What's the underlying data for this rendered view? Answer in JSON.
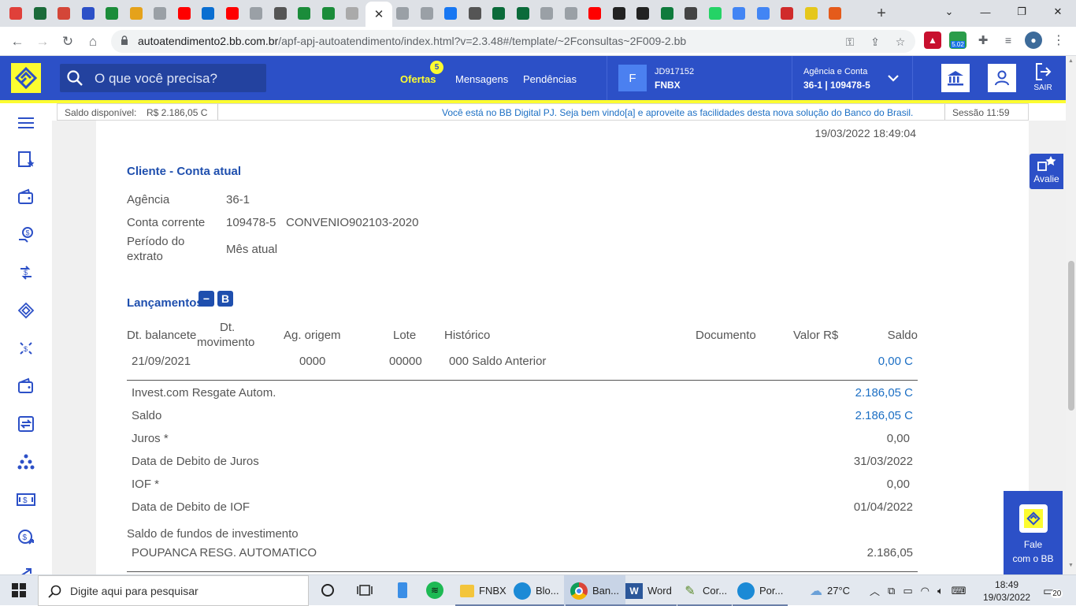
{
  "browser": {
    "tabs": [
      {
        "icon": "download-icon",
        "color": "#e0403a"
      },
      {
        "icon": "ps-icon",
        "color": "#1b6b3a"
      },
      {
        "icon": "gmail-icon",
        "color": "#d44638"
      },
      {
        "icon": "bb-icon",
        "color": "#2c50c7"
      },
      {
        "icon": "flag-icon",
        "color": "#1b8c3a"
      },
      {
        "icon": "pinwheel-icon",
        "color": "#e5a21b"
      },
      {
        "icon": "globe-icon",
        "color": "#9aa0a6"
      },
      {
        "icon": "youtube-icon",
        "color": "#ff0000"
      },
      {
        "icon": "outlook-icon",
        "color": "#0a6ed1"
      },
      {
        "icon": "youtube-icon",
        "color": "#ff0000"
      },
      {
        "icon": "globe-icon",
        "color": "#9aa0a6"
      },
      {
        "icon": "inn-icon",
        "color": "#555555"
      },
      {
        "icon": "flag-icon",
        "color": "#1b8c3a"
      },
      {
        "icon": "flag-icon",
        "color": "#1b8c3a"
      },
      {
        "icon": "doc-icon",
        "color": "#aaaaaa"
      }
    ],
    "active_tab_close": "✕",
    "tabs_after": [
      {
        "icon": "globe-icon",
        "color": "#9aa0a6"
      },
      {
        "icon": "globe-icon",
        "color": "#9aa0a6"
      },
      {
        "icon": "facebook-icon",
        "color": "#1877f2"
      },
      {
        "icon": "speaker-icon",
        "color": "#555555"
      },
      {
        "icon": "lion-icon",
        "color": "#0b6b3a"
      },
      {
        "icon": "lion-icon",
        "color": "#0b6b3a"
      },
      {
        "icon": "globe-icon",
        "color": "#9aa0a6"
      },
      {
        "icon": "globe-icon",
        "color": "#9aa0a6"
      },
      {
        "icon": "youtube-icon",
        "color": "#ff0000"
      },
      {
        "icon": "mic-icon",
        "color": "#222222"
      },
      {
        "icon": "arrow-icon",
        "color": "#222222"
      },
      {
        "icon": "f-icon",
        "color": "#0f7b3c"
      },
      {
        "icon": "circle-icon",
        "color": "#444444"
      },
      {
        "icon": "whatsapp-icon",
        "color": "#25d366"
      },
      {
        "icon": "google-icon",
        "color": "#4285f4"
      },
      {
        "icon": "google-icon",
        "color": "#4285f4"
      },
      {
        "icon": "a-icon",
        "color": "#d02b2b"
      },
      {
        "icon": "bb-icon",
        "color": "#e5c71b"
      },
      {
        "icon": "slides-icon",
        "color": "#e55b1b"
      }
    ],
    "new_tab": "+",
    "url_host": "autoatendimento2.bb.com.br",
    "url_path": "/apf-apj-autoatendimento/index.html?v=2.3.48#/template/~2Fconsultas~2F009-2.bb",
    "extension_badge": "5.02"
  },
  "header": {
    "search_placeholder": "O que você precisa?",
    "nav": {
      "ofertas": "Ofertas",
      "ofertas_badge": "5",
      "mensagens": "Mensagens",
      "pendencias": "Pendências"
    },
    "account_initial": "F",
    "account_id": "JD917152",
    "account_name": "FNBX",
    "agencia_label": "Agência e Conta",
    "agencia_value": "36-1 | 109478-5",
    "sair_label": "SAIR"
  },
  "infobar": {
    "saldo_label": "Saldo disponível:",
    "saldo_value": "R$ 2.186,05 C",
    "welcome": "Você está no BB Digital PJ. Seja bem vindo[a] e aproveite as facilidades desta nova solução do Banco do Brasil.",
    "sessao": "Sessão 11:59"
  },
  "content": {
    "datetime": "19/03/2022 18:49:04",
    "cliente_title": "Cliente - Conta atual",
    "agencia_label": "Agência",
    "agencia_value": "36-1",
    "conta_label": "Conta corrente",
    "conta_value": "109478-5",
    "convenio": "CONVENIO902103-2020",
    "periodo_label_1": "Período do",
    "periodo_label_2": "extrato",
    "periodo_value": "Mês atual",
    "lancamentos_title": "Lançamentos",
    "btn_minus": "−",
    "btn_b": "B",
    "columns": {
      "dt_balancete": "Dt. balancete",
      "dt_movimento_1": "Dt.",
      "dt_movimento_2": "movimento",
      "ag_origem": "Ag. origem",
      "lote": "Lote",
      "historico": "Histórico",
      "documento": "Documento",
      "valor": "Valor R$",
      "saldo": "Saldo"
    },
    "row1": {
      "dt_balancete": "21/09/2021",
      "ag_origem": "0000",
      "lote": "00000",
      "historico": "000 Saldo Anterior",
      "saldo": "0,00 C"
    },
    "summary": [
      {
        "label": "Invest.com Resgate Autom.",
        "value": "2.186,05 C"
      },
      {
        "label": "Saldo",
        "value": "2.186,05 C"
      },
      {
        "label": "Juros *",
        "value": "0,00"
      },
      {
        "label": "Data de Debito de Juros",
        "value": "31/03/2022"
      },
      {
        "label": "IOF *",
        "value": "0,00"
      },
      {
        "label": "Data de Debito de IOF",
        "value": "01/04/2022"
      }
    ],
    "fundos_title": "Saldo de fundos de investimento",
    "fundos_label": "POUPANCA RESG. AUTOMATICO",
    "fundos_value": "2.186,05"
  },
  "avalie_label": "Avalie",
  "fale_line1": "Fale",
  "fale_line2": "com o BB",
  "taskbar": {
    "search_placeholder": "Digite aqui para pesquisar",
    "apps": {
      "fnbx": "FNBX",
      "blo": "Blo...",
      "ban": "Ban...",
      "word": "Word",
      "cor": "Cor...",
      "por": "Por..."
    },
    "weather": "27°C",
    "time": "18:49",
    "date": "19/03/2022",
    "notifications": "20"
  }
}
